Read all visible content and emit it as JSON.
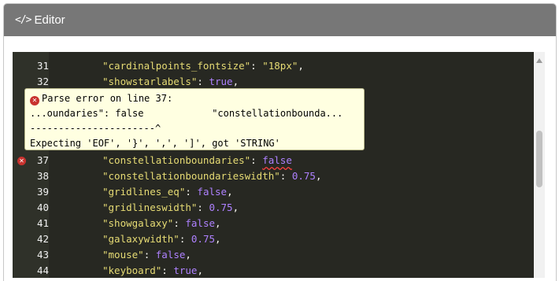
{
  "header": {
    "icon": "</>",
    "title": "Editor"
  },
  "editor": {
    "lines": [
      {
        "num": "31",
        "key": "\"cardinalpoints_fontsize\"",
        "value": "\"18px\"",
        "value_type": "string"
      },
      {
        "num": "32",
        "key": "\"showstarlabels\"",
        "value": "true",
        "value_type": "bool"
      },
      {
        "num": "37",
        "key": "\"constellationboundaries\"",
        "value": "false",
        "value_type": "bool"
      },
      {
        "num": "38",
        "key": "\"constellationboundarieswidth\"",
        "value": "0.75",
        "value_type": "number"
      },
      {
        "num": "39",
        "key": "\"gridlines_eq\"",
        "value": "false",
        "value_type": "bool"
      },
      {
        "num": "40",
        "key": "\"gridlineswidth\"",
        "value": "0.75",
        "value_type": "number"
      },
      {
        "num": "41",
        "key": "\"showgalaxy\"",
        "value": "false",
        "value_type": "bool"
      },
      {
        "num": "42",
        "key": "\"galaxywidth\"",
        "value": "0.75",
        "value_type": "number"
      },
      {
        "num": "43",
        "key": "\"mouse\"",
        "value": "false",
        "value_type": "bool"
      },
      {
        "num": "44",
        "key": "\"keyboard\"",
        "value": "true",
        "value_type": "bool"
      }
    ],
    "error_line": "37",
    "colon": ": ",
    "comma": ","
  },
  "error_tooltip": {
    "line1": "Parse error on line 37:",
    "line2": "...oundaries\": false            \"constellationbounda...",
    "line3": "----------------------^",
    "line4": "Expecting 'EOF', '}', ',', ']', got 'STRING'"
  },
  "colors": {
    "header_bg": "#777777",
    "editor_bg": "#272822",
    "string": "#e6db74",
    "literal": "#ae81ff",
    "error": "#c8322e",
    "tooltip_bg": "#ffffe1"
  }
}
